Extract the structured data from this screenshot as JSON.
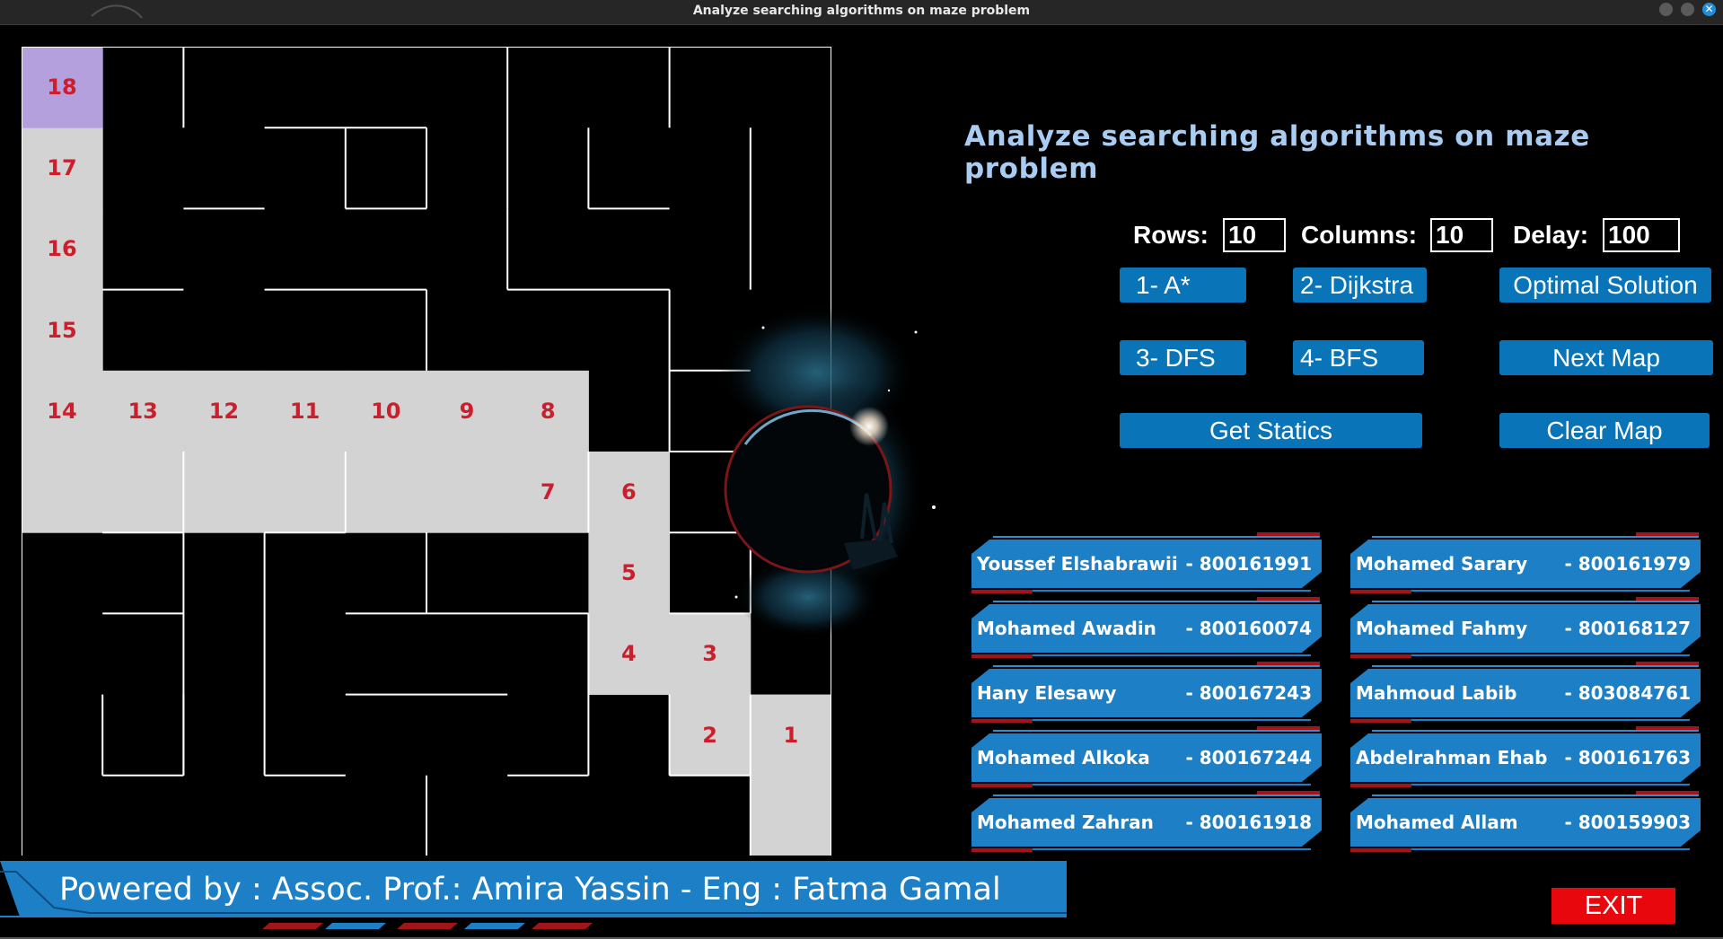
{
  "window": {
    "title": "Analyze searching algorithms on maze problem"
  },
  "heading": "Analyze searching algorithms on maze problem",
  "fields": {
    "rows_label": "Rows:",
    "rows_value": "10",
    "columns_label": "Columns:",
    "columns_value": "10",
    "delay_label": "Delay:",
    "delay_value": "100"
  },
  "buttons": {
    "astar": "1- A*",
    "dijkstra": "2- Dijkstra",
    "optimal": "Optimal Solution",
    "dfs": "3- DFS",
    "bfs": "4- BFS",
    "next_map": "Next Map",
    "statics": "Get Statics",
    "clear_map": "Clear Map",
    "exit": "EXIT"
  },
  "maze": {
    "rows": 10,
    "columns": 10,
    "start_color": "#b3a0dc",
    "path_color": "#d3d3d3",
    "label_color": "#cc1f2d",
    "path": [
      {
        "n": "1",
        "r": 8,
        "c": 9
      },
      {
        "n": "2",
        "r": 8,
        "c": 8
      },
      {
        "n": "3",
        "r": 7,
        "c": 8
      },
      {
        "n": "4",
        "r": 7,
        "c": 7
      },
      {
        "n": "5",
        "r": 6,
        "c": 7
      },
      {
        "n": "6",
        "r": 5,
        "c": 7
      },
      {
        "n": "7",
        "r": 5,
        "c": 6
      },
      {
        "n": "8",
        "r": 4,
        "c": 6
      },
      {
        "n": "9",
        "r": 4,
        "c": 5
      },
      {
        "n": "10",
        "r": 4,
        "c": 4
      },
      {
        "n": "11",
        "r": 4,
        "c": 3
      },
      {
        "n": "12",
        "r": 4,
        "c": 2
      },
      {
        "n": "13",
        "r": 4,
        "c": 1
      },
      {
        "n": "14",
        "r": 4,
        "c": 0
      },
      {
        "n": "15",
        "r": 3,
        "c": 0
      },
      {
        "n": "16",
        "r": 2,
        "c": 0
      },
      {
        "n": "17",
        "r": 1,
        "c": 0
      },
      {
        "n": "18",
        "r": 0,
        "c": 0
      }
    ],
    "extra_path_cells": [
      {
        "r": 9,
        "c": 9
      },
      {
        "r": 5,
        "c": 0
      },
      {
        "r": 5,
        "c": 1
      },
      {
        "r": 5,
        "c": 2
      },
      {
        "r": 5,
        "c": 3
      },
      {
        "r": 5,
        "c": 4
      },
      {
        "r": 5,
        "c": 5
      }
    ]
  },
  "members_left": [
    {
      "name": "Youssef Elshabrawii",
      "id": "- 800161991"
    },
    {
      "name": "Mohamed Awadin",
      "id": "- 800160074"
    },
    {
      "name": "Hany Elesawy",
      "id": "- 800167243"
    },
    {
      "name": "Mohamed Alkoka",
      "id": "- 800167244"
    },
    {
      "name": "Mohamed Zahran",
      "id": "- 800161918"
    }
  ],
  "members_right": [
    {
      "name": "Mohamed Sarary",
      "id": "- 800161979"
    },
    {
      "name": "Mohamed Fahmy",
      "id": "- 800168127"
    },
    {
      "name": "Mahmoud Labib",
      "id": "- 803084761"
    },
    {
      "name": "Abdelrahman Ehab",
      "id": "- 800161763"
    },
    {
      "name": "Mohamed Allam",
      "id": "- 800159903"
    }
  ],
  "footer": "Powered by :  Assoc. Prof.: Amira Yassin - Eng : Fatma Gamal",
  "colors": {
    "button_blue": "#0a74b8",
    "heading_blue": "#a9cdf2",
    "exit_red": "#e8070c",
    "badge_blue": "#1d7fc6"
  }
}
